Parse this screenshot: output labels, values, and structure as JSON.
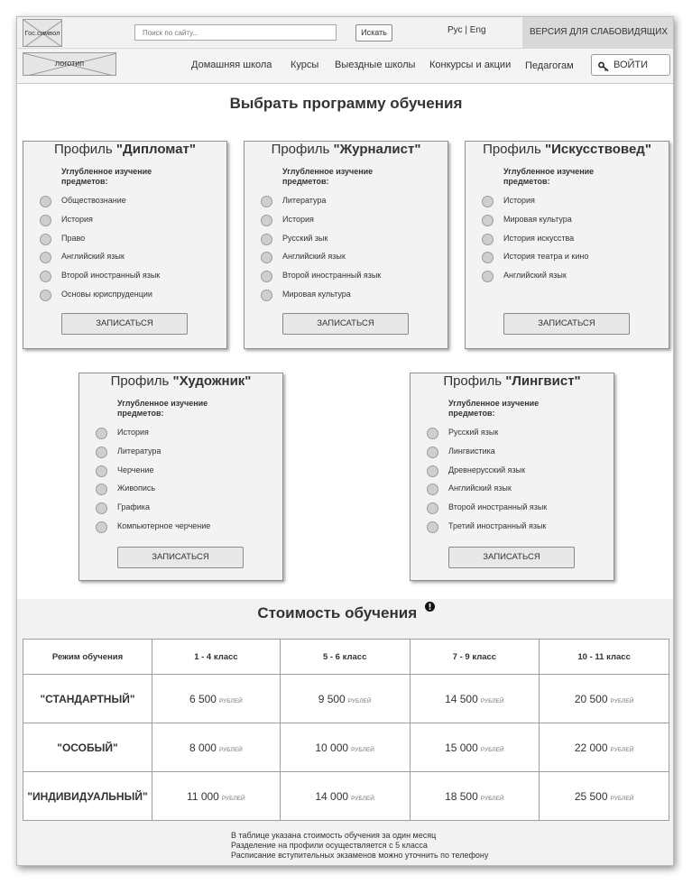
{
  "header": {
    "gov_symbol_label": "Гос.символ",
    "search_placeholder": "Поиск по сайту...",
    "search_button": "Искать",
    "lang_ru": "Рус",
    "lang_sep": " | ",
    "lang_en": "Eng",
    "vision_link": "ВЕРСИЯ ДЛЯ СЛАБОВИДЯЩИХ"
  },
  "nav": {
    "logo_label": "логотип",
    "items": [
      "Домашняя школа",
      "Курсы",
      "Выездные школы",
      "Конкурсы и акции",
      "Педагогам"
    ],
    "login": "ВОЙТИ",
    "login_icon": "key-icon"
  },
  "programs": {
    "title": "Выбрать программу обучения",
    "profile_prefix": "Профиль",
    "subtitle": "Углубленное изучение предметов:",
    "enroll_label": "ЗАПИСАТЬСЯ",
    "cards": [
      {
        "name": "\"Дипломат\"",
        "subjects": [
          "Обществознание",
          "История",
          "Право",
          "Английский язык",
          "Второй иностранный язык",
          "Основы юриспруденции"
        ]
      },
      {
        "name": "\"Журналист\"",
        "subjects": [
          "Литература",
          "История",
          "Русский зык",
          "Английский язык",
          "Второй иностранный язык",
          "Мировая культура"
        ]
      },
      {
        "name": "\"Искусствовед\"",
        "subjects": [
          "История",
          "Мировая культура",
          "История искусства",
          "История театра и кино",
          "Английский язык"
        ]
      },
      {
        "name": "\"Художник\"",
        "subjects": [
          "История",
          "Литература",
          "Черчение",
          "Живопись",
          "Графика",
          "Компьютерное черчение"
        ]
      },
      {
        "name": "\"Лингвист\"",
        "subjects": [
          "Русский язык",
          "Лингвистика",
          "Древнерусский язык",
          "Английский язык",
          "Второй иностранный язык",
          "Третий иностранный язык"
        ]
      }
    ]
  },
  "pricing": {
    "title": "Стоимость обучения",
    "info_icon": "exclamation-circle-icon",
    "headers": [
      "Режим обучения",
      "1 - 4 класс",
      "5 - 6 класс",
      "7 - 9 класс",
      "10 - 11 класс"
    ],
    "unit": "РУБЛЕЙ",
    "rows": [
      {
        "mode": "\"СТАНДАРТНЫЙ\"",
        "prices": [
          "6 500",
          "9 500",
          "14 500",
          "20 500"
        ]
      },
      {
        "mode": "\"ОСОБЫЙ\"",
        "prices": [
          "8 000",
          "10 000",
          "15 000",
          "22 000"
        ]
      },
      {
        "mode": "\"ИНДИВИДУАЛЬНЫЙ\"",
        "prices": [
          "11 000",
          "14 000",
          "18 500",
          "25 500"
        ]
      }
    ],
    "notes": [
      "В таблице указана стоимость обучения за один месяц",
      "Разделение на профили осуществляется с 5 класса",
      "Расписание вступительных экзаменов можно уточнить по телефону"
    ]
  }
}
